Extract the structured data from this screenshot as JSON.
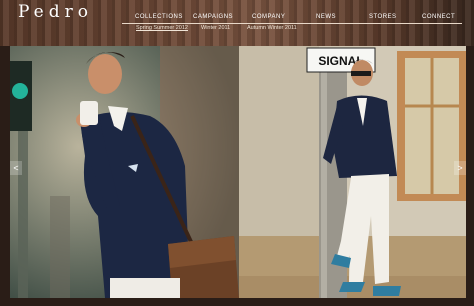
{
  "brand": {
    "logo": "Pedro"
  },
  "nav": {
    "items": [
      {
        "label": "COLLECTIONS"
      },
      {
        "label": "CAMPAIGNS"
      },
      {
        "label": "COMPANY"
      },
      {
        "label": "NEWS"
      },
      {
        "label": "STORES"
      },
      {
        "label": "CONNECT"
      }
    ],
    "subitems": [
      {
        "label": "Spring Summer 2012",
        "active": true
      },
      {
        "label": "Winter 2011",
        "active": false
      },
      {
        "label": "Autumn Winter 2011",
        "active": false
      }
    ]
  },
  "gallery": {
    "prev_label": "<",
    "next_label": ">"
  },
  "photo_right": {
    "sign_text": "SIGNAL"
  },
  "colors": {
    "background": "#2a1d17",
    "header": "#6a4634",
    "nav_text": "#ffffff"
  }
}
